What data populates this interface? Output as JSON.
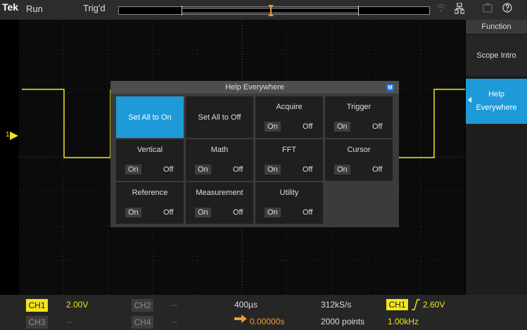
{
  "top_bar": {
    "brand": "Tek",
    "run_state": "Run",
    "trigger_state": "Trig'd"
  },
  "side_panel": {
    "title": "Function",
    "scope_intro": "Scope Intro",
    "help_everywhere_line1": "Help",
    "help_everywhere_line2": "Everywhere"
  },
  "dialog": {
    "title": "Help Everywhere",
    "badge": "M",
    "set_all_on": "Set All to On",
    "set_all_off": "Set All to Off",
    "on_label": "On",
    "off_label": "Off",
    "acquire": "Acquire",
    "trigger": "Trigger",
    "vertical": "Vertical",
    "math": "Math",
    "fft": "FFT",
    "cursor": "Cursor",
    "reference": "Reference",
    "measurement": "Measurement",
    "utility": "Utility"
  },
  "channel_marker": "1",
  "bottom_bar": {
    "ch1": "CH1",
    "ch1_scale": "2.00V",
    "ch2": "CH2",
    "ch2_scale": "--",
    "ch3": "CH3",
    "ch3_scale": "--",
    "ch4": "CH4",
    "ch4_scale": "--",
    "timebase": "400µs",
    "delay": "0.00000s",
    "sample_rate": "312kS/s",
    "record_length": "2000 points",
    "trigger_source": "CH1",
    "trigger_level": "2.60V",
    "frequency": "1.00kHz"
  },
  "colors": {
    "ch1": "#f2e51a",
    "accent": "#1e9ad8",
    "delay_arrow": "#f29a2e"
  },
  "icons": [
    "network-icon",
    "storage-icon",
    "help-icon",
    "wifi-icon"
  ]
}
